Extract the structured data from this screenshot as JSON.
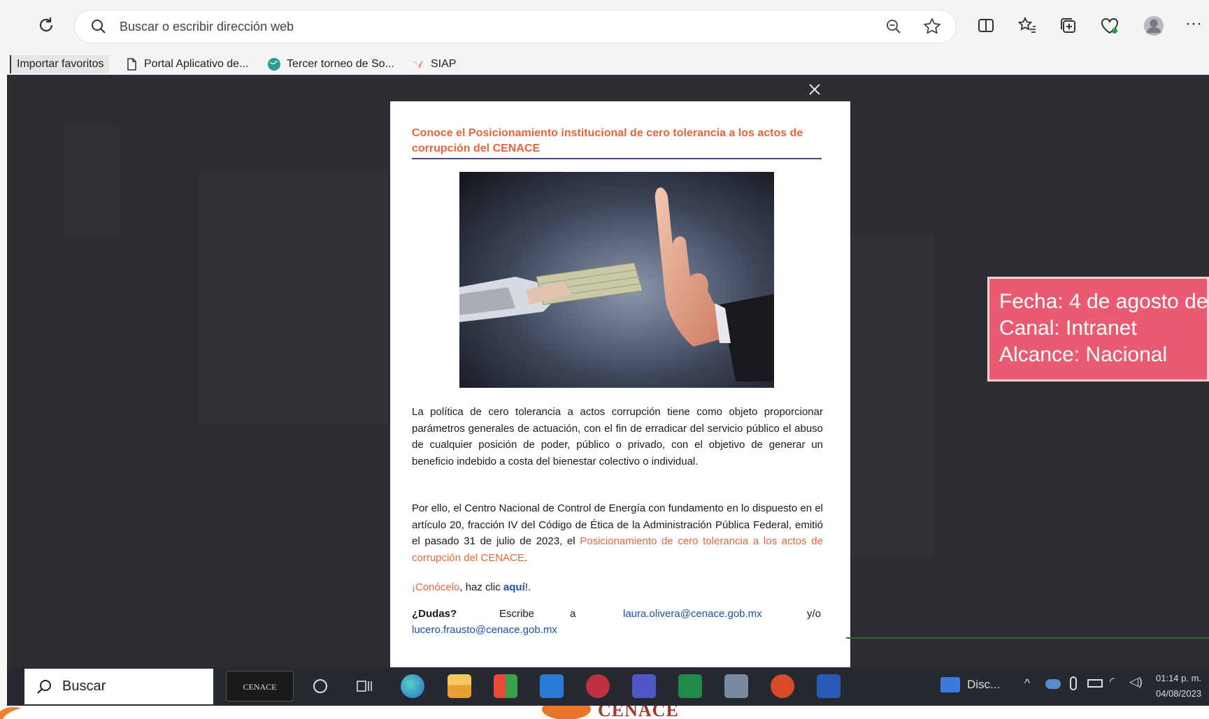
{
  "browser": {
    "address_placeholder": "Buscar o escribir dirección web",
    "toolbar_icons": [
      "reload-icon",
      "search-icon",
      "zoom-out-icon",
      "favorite-star-icon",
      "split-screen-icon",
      "favorites-icon",
      "collections-icon",
      "browser-essentials-icon",
      "profile-avatar",
      "more-icon"
    ]
  },
  "favorites": [
    {
      "label": "Importar favoritos",
      "icon": ""
    },
    {
      "label": "Portal Aplicativo de...",
      "icon": "page-icon"
    },
    {
      "label": "Tercer torneo de So...",
      "icon": "globe-icon"
    },
    {
      "label": "SIAP",
      "icon": "siap-icon"
    }
  ],
  "modal": {
    "title": "Conoce el Posicionamiento institucional de cero tolerancia a los actos de corrupción del CENACE",
    "para1": "La política de cero tolerancia a actos corrupción tiene como objeto proporcionar parámetros generales de actuación, con el fin de erradicar del servicio público el abuso de cualquier posición de poder, público o privado, con el objetivo de generar un beneficio indebido a costa del bienestar colectivo o individual.",
    "para2_text": "Por ello, el Centro Nacional de Control de Energía con fundamento en lo dispuesto en el artículo 20, fracción IV del Código de Ética de la Administración Pública Federal, emitió el pasado 31 de julio de 2023, el ",
    "para2_link": "Posicionamiento de cero tolerancia a los actos de corrupción del CENACE",
    "para2_end": ".",
    "cta_orange": "¡Conócelo",
    "cta_mid": ", haz clic ",
    "cta_link": "aquí",
    "cta_end": "!.",
    "dudas_label": "¿Dudas?",
    "dudas_escribe": "Escribe",
    "dudas_a": "a",
    "email1": "laura.olivera@cenace.gob.mx",
    "dudas_yo": "y/o",
    "email2": "lucero.frausto@cenace.gob.mx"
  },
  "infobox": {
    "line1": "Fecha: 4 de agosto de",
    "line2": "Canal: Intranet",
    "line3": "Alcance: Nacional",
    "color": "#ea5b72"
  },
  "taskbar": {
    "search_label": "Buscar",
    "pinned_label": "CENACE",
    "apps": [
      "edge-icon",
      "file-explorer-icon",
      "store-icon",
      "mail-icon",
      "app-icon",
      "teams-icon",
      "excel-icon",
      "calculator-icon",
      "powerpoint-icon",
      "word-icon"
    ],
    "tray_label": "Disc...",
    "time": "01:14 p. m.",
    "date": "04/08/2023"
  },
  "bottom_logo": "CENACE"
}
